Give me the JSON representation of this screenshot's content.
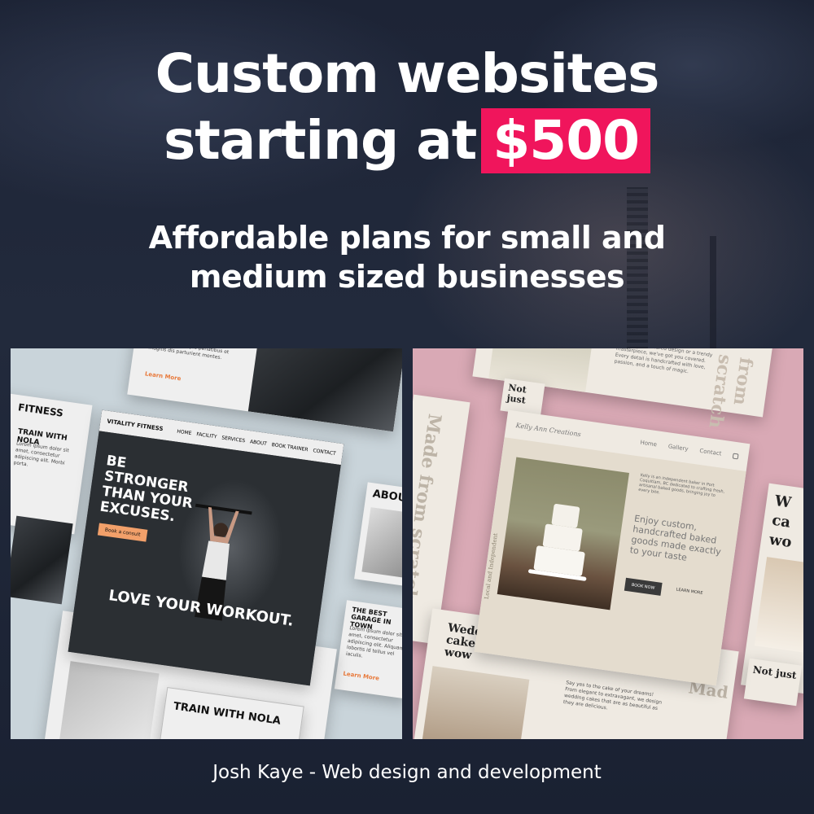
{
  "headline": {
    "line1": "Custom websites",
    "line2": "starting at",
    "price": "$500"
  },
  "subhead": {
    "line1": "Affordable plans for small and",
    "line2": "medium sized businesses"
  },
  "footer": "Josh Kaye - Web design and development",
  "colors": {
    "accent": "#f0155c",
    "background": "#1b2233",
    "gym_orange": "#e87a3c",
    "pink_panel": "#d9a9b5"
  },
  "gym": {
    "brand": "VITALITY FITNESS",
    "nav": [
      "HOME",
      "FACILITY",
      "SERVICES",
      "ABOUT",
      "BOOK TRAINER",
      "CONTACT"
    ],
    "hero_heading": "BE STRONGER THAN YOUR EXCUSES.",
    "consult_button": "Book a consult",
    "tagline": "LOVE YOUR WORKOUT.",
    "side_title": "FITNESS",
    "train": "TRAIN WITH NOLA",
    "about_short": "ABOUT",
    "about_full": "ABOUT VITALITY FITNESS",
    "train_bottom": "TRAIN WITH NOLA",
    "garage": "THE BEST GARAGE IN TOWN",
    "learn_more": "Learn More",
    "learn_more_small": "Learn More"
  },
  "bakery": {
    "brand": "Kelly Ann Creations",
    "nav": [
      "Home",
      "Gallery",
      "Contact"
    ],
    "tagline": "Enjoy custom, handcrafted baked goods made exactly to your taste",
    "book_button": "BOOK NOW",
    "learn_button": "LEARN MORE",
    "vertical": "Local and Independent",
    "made_from_scratch": "Made from scratch",
    "from_scratch": "from scratch",
    "not_just": "Not just",
    "wedding": "Wedding cakes that wow",
    "say_yes": "Say yes to the cake of your dreams! From elegant to extravagant, we design wedding cakes that are as beautiful as they are delicious.",
    "top_blurb": "want a classic tiered design or a trendy masterpiece, we've got you covered. Every detail is handcrafted with love, passion, and a touch of magic.",
    "intro": "Kelly is an independent baker in Port Coquitlam, BC dedicated to crafting fresh, artisanal baked goods, bringing joy to every bite.",
    "wo": "W",
    "ca": "ca",
    "wo2": "wo",
    "mad": "Mad"
  }
}
